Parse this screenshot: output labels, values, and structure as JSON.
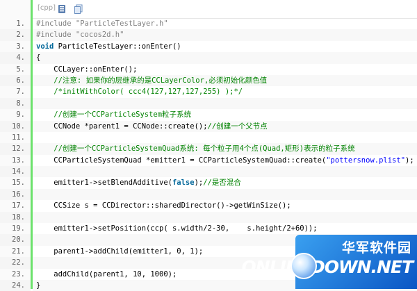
{
  "toolbar": {
    "language_label": "[cpp]",
    "icons": [
      "view-source-icon",
      "copy-icon"
    ]
  },
  "code_lines": [
    {
      "num": "1.",
      "segments": [
        {
          "t": "#include ",
          "c": "pp"
        },
        {
          "t": "\"ParticleTestLayer.h\"",
          "c": "pp"
        }
      ]
    },
    {
      "num": "2.",
      "segments": [
        {
          "t": "#include ",
          "c": "pp"
        },
        {
          "t": "\"cocos2d.h\"",
          "c": "pp"
        }
      ]
    },
    {
      "num": "3.",
      "segments": [
        {
          "t": "void",
          "c": "kw"
        },
        {
          "t": " ParticleTestLayer::onEnter()",
          "c": ""
        }
      ]
    },
    {
      "num": "4.",
      "segments": [
        {
          "t": "{",
          "c": ""
        }
      ]
    },
    {
      "num": "5.",
      "segments": [
        {
          "t": "    CCLayer::onEnter();",
          "c": ""
        }
      ]
    },
    {
      "num": "6.",
      "segments": [
        {
          "t": "    //注意: 如果你的层继承的是CCLayerColor,必须初始化颜色值",
          "c": "cmt"
        }
      ]
    },
    {
      "num": "7.",
      "segments": [
        {
          "t": "    /*initWithColor( ccc4(127,127,127,255) );*/",
          "c": "cmt"
        }
      ]
    },
    {
      "num": "8.",
      "segments": [
        {
          "t": "",
          "c": ""
        }
      ]
    },
    {
      "num": "9.",
      "segments": [
        {
          "t": "    //创建一个CCParticleSystem粒子系统",
          "c": "cmt"
        }
      ]
    },
    {
      "num": "10.",
      "segments": [
        {
          "t": "    CCNode *parent1 = CCNode::create();",
          "c": ""
        },
        {
          "t": "//创建一个父节点",
          "c": "cmt"
        }
      ]
    },
    {
      "num": "11.",
      "segments": [
        {
          "t": "",
          "c": ""
        }
      ]
    },
    {
      "num": "12.",
      "segments": [
        {
          "t": "    //创建一个CCParticleSystemQuad系统: 每个粒子用4个点(Quad,矩形)表示的粒子系统",
          "c": "cmt"
        }
      ]
    },
    {
      "num": "13.",
      "segments": [
        {
          "t": "    CCParticleSystemQuad *emitter1 = CCParticleSystemQuad::create(",
          "c": ""
        },
        {
          "t": "\"pottersnow.plist\"",
          "c": "str"
        },
        {
          "t": ");",
          "c": ""
        }
      ]
    },
    {
      "num": "14.",
      "segments": [
        {
          "t": "",
          "c": ""
        }
      ]
    },
    {
      "num": "15.",
      "segments": [
        {
          "t": "    emitter1->setBlendAdditive(",
          "c": ""
        },
        {
          "t": "false",
          "c": "kw"
        },
        {
          "t": ");",
          "c": ""
        },
        {
          "t": "//是否混合",
          "c": "cmt"
        }
      ]
    },
    {
      "num": "16.",
      "segments": [
        {
          "t": "",
          "c": ""
        }
      ]
    },
    {
      "num": "17.",
      "segments": [
        {
          "t": "    CCSize s = CCDirector::sharedDirector()->getWinSize();",
          "c": ""
        }
      ]
    },
    {
      "num": "18.",
      "segments": [
        {
          "t": "",
          "c": ""
        }
      ]
    },
    {
      "num": "19.",
      "segments": [
        {
          "t": "    emitter1->setPosition(ccp( s.width/2-30,    s.height/2+60));",
          "c": ""
        }
      ]
    },
    {
      "num": "20.",
      "segments": [
        {
          "t": "",
          "c": ""
        }
      ]
    },
    {
      "num": "21.",
      "segments": [
        {
          "t": "    parent1->addChild(emitter1, 0, 1);",
          "c": ""
        }
      ]
    },
    {
      "num": "22.",
      "segments": [
        {
          "t": "",
          "c": ""
        }
      ]
    },
    {
      "num": "23.",
      "segments": [
        {
          "t": "    addChild(parent1, 10, 1000);",
          "c": ""
        }
      ]
    },
    {
      "num": "24.",
      "segments": [
        {
          "t": "}",
          "c": ""
        }
      ]
    }
  ],
  "watermark": {
    "title_cn": "华军软件园",
    "title_en": "ONLINEDOWN.NET"
  },
  "colors": {
    "gutter_border": "#6ce26c",
    "keyword": "#006699",
    "string": "#0000ff",
    "comment": "#008200",
    "preprocessor": "#808080"
  }
}
